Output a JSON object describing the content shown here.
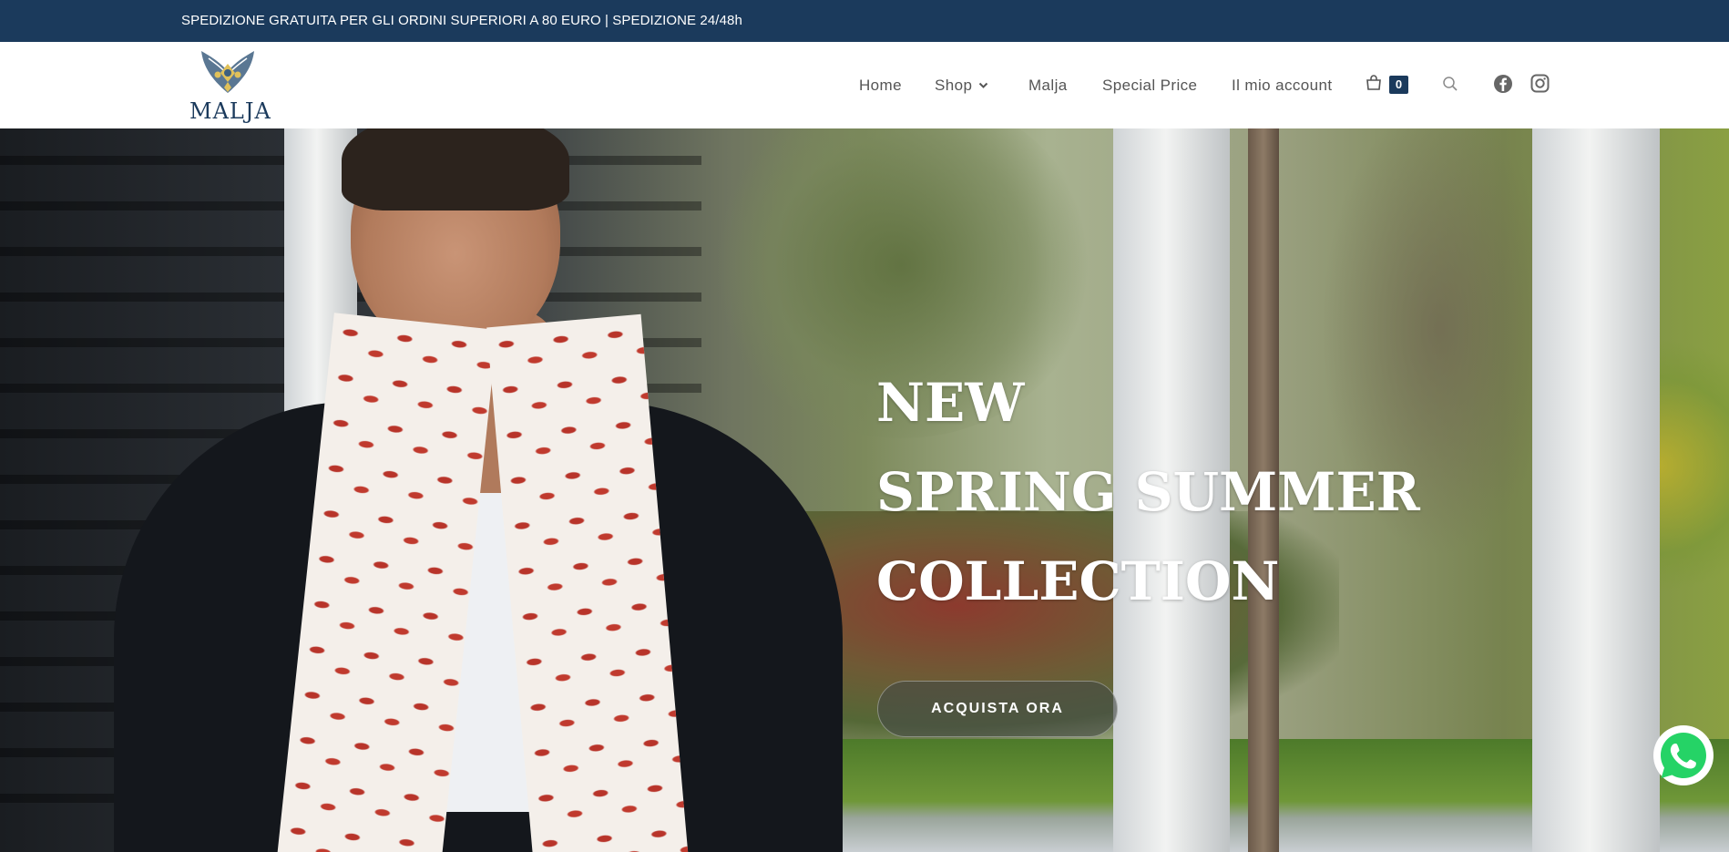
{
  "topbar": {
    "announcement": "SPEDIZIONE GRATUITA PER GLI ORDINI SUPERIORI A 80 EURO | SPEDIZIONE 24/48h"
  },
  "brand": {
    "name": "MALJA",
    "primary_color": "#1b3a5c"
  },
  "nav": {
    "items": [
      {
        "label": "Home",
        "icon": null
      },
      {
        "label": "Shop",
        "icon": "chevron-down-icon"
      },
      {
        "label": "Malja",
        "icon": null
      },
      {
        "label": "Special Price",
        "icon": null
      },
      {
        "label": "Il mio account",
        "icon": null
      }
    ],
    "cart": {
      "icon": "shopping-bag-icon",
      "count": "0"
    },
    "search_icon": "search-icon",
    "social": [
      "facebook-icon",
      "instagram-icon"
    ]
  },
  "hero": {
    "title_lines": [
      "NEW",
      "SPRING SUMMER",
      "COLLECTION"
    ],
    "cta_label": "ACQUISTA ORA"
  },
  "widgets": {
    "whatsapp_icon": "whatsapp-icon",
    "whatsapp_color": "#25d366"
  }
}
